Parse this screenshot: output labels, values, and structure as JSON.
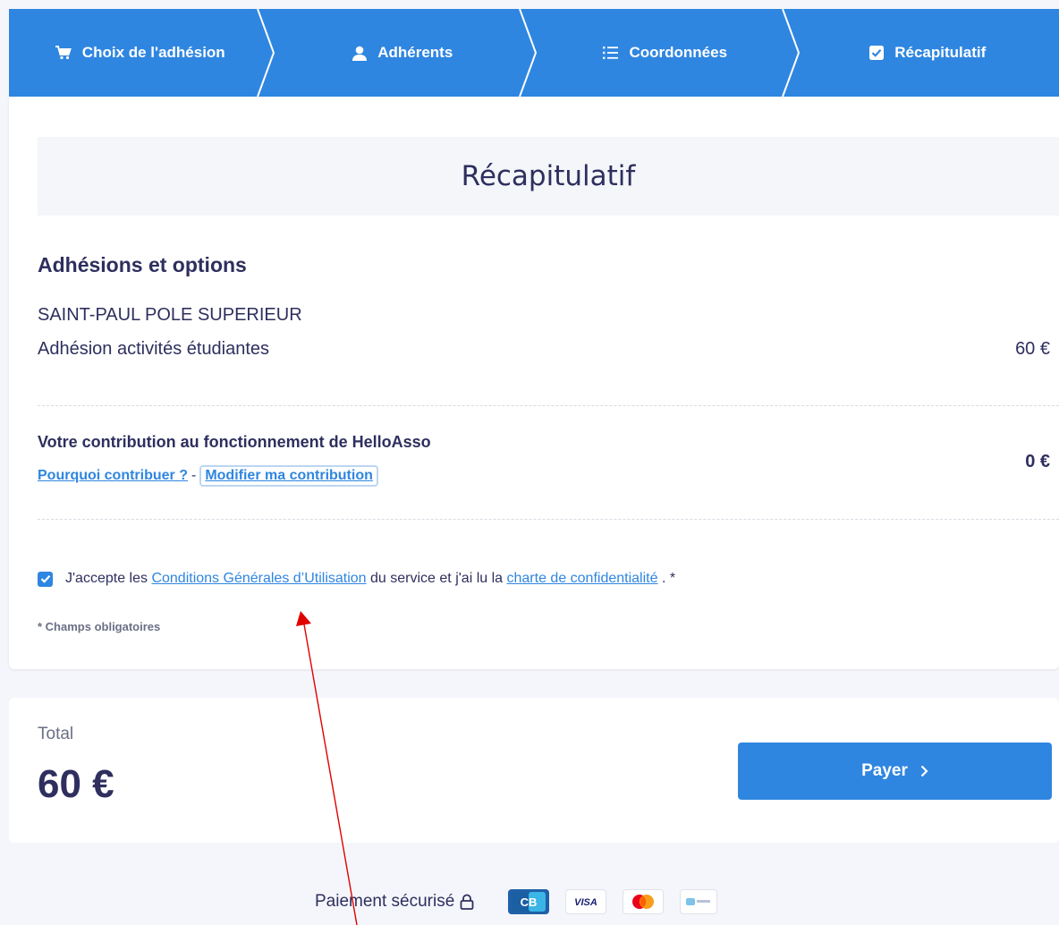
{
  "stepper": {
    "steps": [
      {
        "label": "Choix de l'adhésion",
        "icon": "cart-icon"
      },
      {
        "label": "Adhérents",
        "icon": "user-icon"
      },
      {
        "label": "Coordonnées",
        "icon": "list-icon"
      },
      {
        "label": "Récapitulatif",
        "icon": "checkbox-icon"
      }
    ]
  },
  "summary": {
    "title": "Récapitulatif",
    "section_title": "Adhésions et options",
    "organization": "SAINT-PAUL POLE SUPERIEUR",
    "membership": {
      "name": "Adhésion activités étudiantes",
      "price": "60 €"
    },
    "contribution": {
      "title": "Votre contribution au fonctionnement de HelloAsso",
      "why_link": "Pourquoi contribuer ?",
      "separator": "-",
      "modify_link": "Modifier ma contribution",
      "price": "0 €"
    },
    "terms": {
      "checked": true,
      "prefix": "J'accepte les",
      "cgu_link": "Conditions Générales d’Utilisation",
      "middle": "du service et j'ai lu la",
      "privacy_link": "charte de confidentialité",
      "suffix": ". *"
    },
    "required_note": "* Champs obligatoires"
  },
  "total": {
    "label": "Total",
    "value": "60 €",
    "pay_button": "Payer"
  },
  "footer": {
    "secure_text": "Paiement sécurisé",
    "logos": [
      "CB",
      "VISA",
      "Mastercard",
      "Paylib"
    ]
  },
  "colors": {
    "primary": "#2f86e0",
    "text": "#2e2f5e",
    "annotation": "#e00000"
  }
}
